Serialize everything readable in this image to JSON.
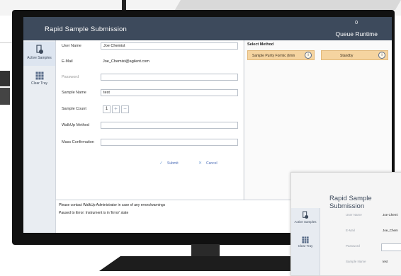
{
  "app": {
    "title": "Rapid Sample Submission",
    "queue_count": "0",
    "queue_label": "Queue Runtime"
  },
  "sidebar": {
    "items": [
      {
        "label": "Active Samples",
        "icon": "sample-vial-icon"
      },
      {
        "label": "Clear Tray",
        "icon": "tray-grid-icon"
      }
    ]
  },
  "form": {
    "user_name_label": "User Name",
    "user_name_value": "Joe Chemist",
    "email_label": "E-Mail",
    "email_value": "Joe_Chemist@agilent.com",
    "password_label": "Password",
    "password_value": "",
    "sample_name_label": "Sample Name",
    "sample_name_value": "test",
    "sample_count_label": "Sample Count",
    "sample_count_value": "1",
    "plus_symbol": "+",
    "minus_symbol": "−",
    "walkup_method_label": "WalkUp Method",
    "walkup_method_value": "",
    "mass_confirmation_label": "Mass Confirmation",
    "mass_confirmation_value": "",
    "submit_label": "Submit",
    "submit_symbol": "✓",
    "cancel_label": "Cancel",
    "cancel_symbol": "✕"
  },
  "methods": {
    "title": "Select Method",
    "items": [
      {
        "label": "Sample Purity Formic (Imin"
      },
      {
        "label": "Standby"
      }
    ],
    "info_symbol": "i"
  },
  "status": {
    "lines": [
      "Please contact WalkUp Administrator in case of any errors/warnings",
      "Paused to Error: Instrument is in 'Error' state"
    ]
  },
  "second_window": {
    "title": "Rapid Sample Submission",
    "sidebar_items": [
      {
        "label": "Active Samples"
      },
      {
        "label": "Clear Tray"
      }
    ],
    "labels": [
      "User Name",
      "E-Mail",
      "Password",
      "Sample Name"
    ],
    "values": [
      "Joe Chemi",
      "Joe_Chem",
      "",
      "test"
    ]
  },
  "colors": {
    "header": "#3d4a5c",
    "method_card": "#f5d4a0",
    "link_blue": "#4b6cb7"
  }
}
